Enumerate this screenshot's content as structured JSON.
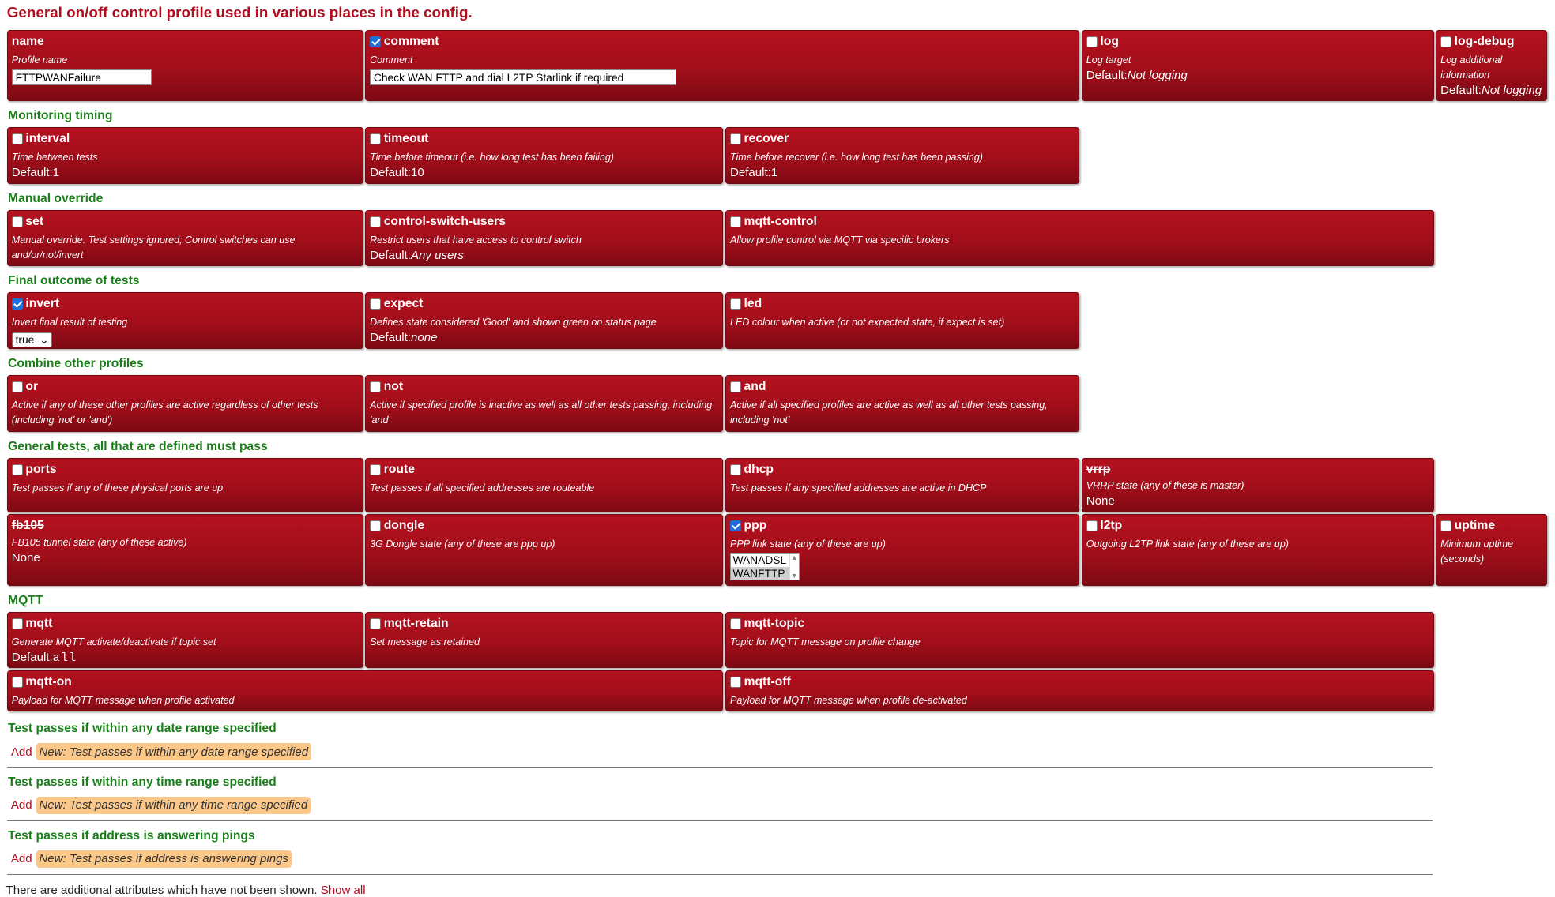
{
  "title": "General on/off control profile used in various places in the config.",
  "top": {
    "name": {
      "label": "name",
      "desc": "Profile name",
      "value": "FTTPWANFailure"
    },
    "comment": {
      "label": "comment",
      "desc": "Comment",
      "value": "Check WAN FTTP and dial L2TP Starlink if required"
    },
    "log": {
      "label": "log",
      "desc": "Log target",
      "default_prefix": "Default:",
      "default": "Not logging"
    },
    "log_debug": {
      "label": "log-debug",
      "desc": "Log additional information",
      "default_prefix": "Default:",
      "default": "Not logging"
    }
  },
  "sections": {
    "monitoring": "Monitoring timing",
    "manual": "Manual override",
    "final": "Final outcome of tests",
    "combine": "Combine other profiles",
    "general": "General tests, all that are defined must pass",
    "mqtt": "MQTT",
    "date": "Test passes if within any date range specified",
    "time": "Test passes if within any time range specified",
    "ping": "Test passes if address is answering pings"
  },
  "monitoring": {
    "interval": {
      "label": "interval",
      "desc": "Time between tests",
      "default_prefix": "Default:",
      "default": "1"
    },
    "timeout": {
      "label": "timeout",
      "desc": "Time before timeout (i.e. how long test has been failing)",
      "default_prefix": "Default:",
      "default": "10"
    },
    "recover": {
      "label": "recover",
      "desc": "Time before recover (i.e. how long test has been passing)",
      "default_prefix": "Default:",
      "default": "1"
    }
  },
  "manual": {
    "set": {
      "label": "set",
      "desc": "Manual override. Test settings ignored; Control switches can use and/or/not/invert"
    },
    "control_switch_users": {
      "label": "control-switch-users",
      "desc": "Restrict users that have access to control switch",
      "default_prefix": "Default:",
      "default": "Any users"
    },
    "mqtt_control": {
      "label": "mqtt-control",
      "desc": "Allow profile control via MQTT via specific brokers"
    }
  },
  "final": {
    "invert": {
      "label": "invert",
      "desc": "Invert final result of testing",
      "value": "true"
    },
    "expect": {
      "label": "expect",
      "desc": "Defines state considered 'Good' and shown green on status page",
      "default_prefix": "Default:",
      "default": "none"
    },
    "led": {
      "label": "led",
      "desc": "LED colour when active (or not expected state, if expect is set)"
    }
  },
  "combine": {
    "or": {
      "label": "or",
      "desc": "Active if any of these other profiles are active regardless of other tests (including 'not' or 'and')"
    },
    "not": {
      "label": "not",
      "desc": "Active if specified profile is inactive as well as all other tests passing, including 'and'"
    },
    "and": {
      "label": "and",
      "desc": "Active if all specified profiles are active as well as all other tests passing, including 'not'"
    }
  },
  "general": {
    "ports": {
      "label": "ports",
      "desc": "Test passes if any of these physical ports are up"
    },
    "route": {
      "label": "route",
      "desc": "Test passes if all specified addresses are routeable"
    },
    "dhcp": {
      "label": "dhcp",
      "desc": "Test passes if any specified addresses are active in DHCP"
    },
    "vrrp": {
      "label": "vrrp",
      "desc": "VRRP state (any of these is master)",
      "value": "None"
    },
    "fb105": {
      "label": "fb105",
      "desc": "FB105 tunnel state (any of these active)",
      "value": "None"
    },
    "dongle": {
      "label": "dongle",
      "desc": "3G Dongle state (any of these are ppp up)"
    },
    "ppp": {
      "label": "ppp",
      "desc": "PPP link state (any of these are up)",
      "options": [
        "WANADSL",
        "WANFTTP"
      ]
    },
    "l2tp": {
      "label": "l2tp",
      "desc": "Outgoing L2TP link state (any of these are up)"
    },
    "uptime": {
      "label": "uptime",
      "desc": "Minimum uptime (seconds)"
    }
  },
  "mqtt": {
    "mqtt": {
      "label": "mqtt",
      "desc": "Generate MQTT activate/deactivate if topic set",
      "default_prefix": "Default:",
      "default": "all"
    },
    "mqtt_retain": {
      "label": "mqtt-retain",
      "desc": "Set message as retained"
    },
    "mqtt_topic": {
      "label": "mqtt-topic",
      "desc": "Topic for MQTT message on profile change"
    },
    "mqtt_on": {
      "label": "mqtt-on",
      "desc": "Payload for MQTT message when profile activated"
    },
    "mqtt_off": {
      "label": "mqtt-off",
      "desc": "Payload for MQTT message when profile de-activated"
    }
  },
  "adds": {
    "add_label": "Add",
    "date_btn": "New: Test passes if within any date range specified",
    "time_btn": "New: Test passes if within any time range specified",
    "ping_btn": "New: Test passes if address is answering pings"
  },
  "footer": {
    "text": "There are additional attributes which have not been shown.",
    "link": "Show all"
  }
}
